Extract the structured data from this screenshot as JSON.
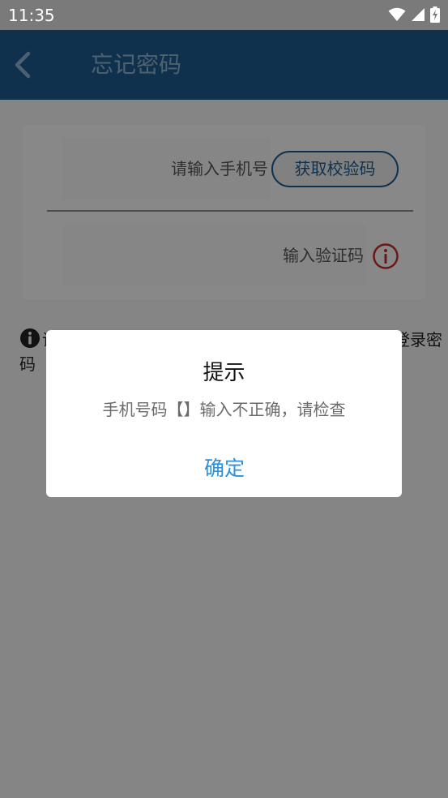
{
  "status_bar": {
    "time": "11:35",
    "icons": [
      "wifi-icon",
      "signal-icon",
      "battery-charging-icon"
    ]
  },
  "app_bar": {
    "back_icon": "chevron-left-icon",
    "title": "忘记密码"
  },
  "form": {
    "phone_placeholder": "请输入手机号",
    "get_code_label": "获取校验码",
    "code_placeholder": "输入验证码",
    "error_icon": "info-circle-icon",
    "error_color": "#c62828"
  },
  "hint": {
    "icon": "info-filled-icon",
    "text_left": "请",
    "text_right": "登录密",
    "text_wrap": "码"
  },
  "dialog": {
    "title": "提示",
    "message": "手机号码【】输入不正确，请检查",
    "confirm_label": "确定"
  },
  "colors": {
    "primary": "#1e5a8c",
    "accent": "#2f8fd8"
  }
}
